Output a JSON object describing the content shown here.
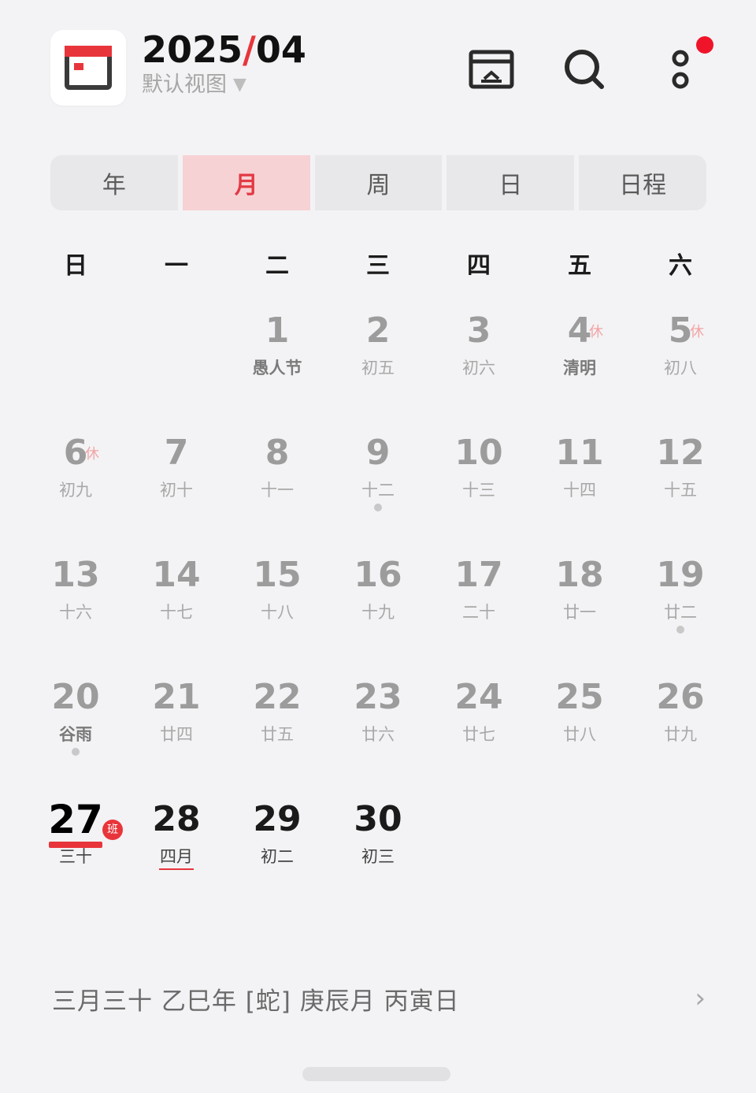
{
  "header": {
    "year": "2025",
    "separator": "/",
    "month": "04",
    "view_switch": "默认视图",
    "view_caret": "▼",
    "icons": [
      "calendar-app-icon",
      "today-icon",
      "search-icon",
      "more-icon"
    ],
    "notification_badge": true
  },
  "tabs": [
    {
      "label": "年",
      "active": false
    },
    {
      "label": "月",
      "active": true
    },
    {
      "label": "周",
      "active": false
    },
    {
      "label": "日",
      "active": false
    },
    {
      "label": "日程",
      "active": false
    }
  ],
  "weekdays": [
    "日",
    "一",
    "二",
    "三",
    "四",
    "五",
    "六"
  ],
  "calendar": {
    "leading_blanks": 2,
    "days": [
      {
        "num": "1",
        "lunar": "愚人节",
        "festival": true
      },
      {
        "num": "2",
        "lunar": "初五"
      },
      {
        "num": "3",
        "lunar": "初六"
      },
      {
        "num": "4",
        "lunar": "清明",
        "festival": true,
        "rest": "休"
      },
      {
        "num": "5",
        "lunar": "初八",
        "rest": "休"
      },
      {
        "num": "6",
        "lunar": "初九",
        "rest": "休"
      },
      {
        "num": "7",
        "lunar": "初十"
      },
      {
        "num": "8",
        "lunar": "十一"
      },
      {
        "num": "9",
        "lunar": "十二",
        "dot": true
      },
      {
        "num": "10",
        "lunar": "十三"
      },
      {
        "num": "11",
        "lunar": "十四"
      },
      {
        "num": "12",
        "lunar": "十五"
      },
      {
        "num": "13",
        "lunar": "十六"
      },
      {
        "num": "14",
        "lunar": "十七"
      },
      {
        "num": "15",
        "lunar": "十八"
      },
      {
        "num": "16",
        "lunar": "十九"
      },
      {
        "num": "17",
        "lunar": "二十"
      },
      {
        "num": "18",
        "lunar": "廿一"
      },
      {
        "num": "19",
        "lunar": "廿二",
        "dot": true
      },
      {
        "num": "20",
        "lunar": "谷雨",
        "festival": true,
        "dot": true
      },
      {
        "num": "21",
        "lunar": "廿四"
      },
      {
        "num": "22",
        "lunar": "廿五"
      },
      {
        "num": "23",
        "lunar": "廿六"
      },
      {
        "num": "24",
        "lunar": "廿七"
      },
      {
        "num": "25",
        "lunar": "廿八"
      },
      {
        "num": "26",
        "lunar": "廿九"
      },
      {
        "num": "27",
        "lunar": "三十",
        "today": true,
        "work": "班"
      },
      {
        "num": "28",
        "lunar": "四月",
        "near": true,
        "lunar_underline": true
      },
      {
        "num": "29",
        "lunar": "初二",
        "near": true
      },
      {
        "num": "30",
        "lunar": "初三",
        "near": true
      }
    ]
  },
  "footer": {
    "text": "三月三十  乙巳年 [蛇] 庚辰月 丙寅日",
    "chevron": "›"
  },
  "colors": {
    "accent": "#e8353b",
    "background": "#f3f3f5",
    "tab_active_bg": "#f7d2d5",
    "rest_label": "#f2a4a6"
  }
}
